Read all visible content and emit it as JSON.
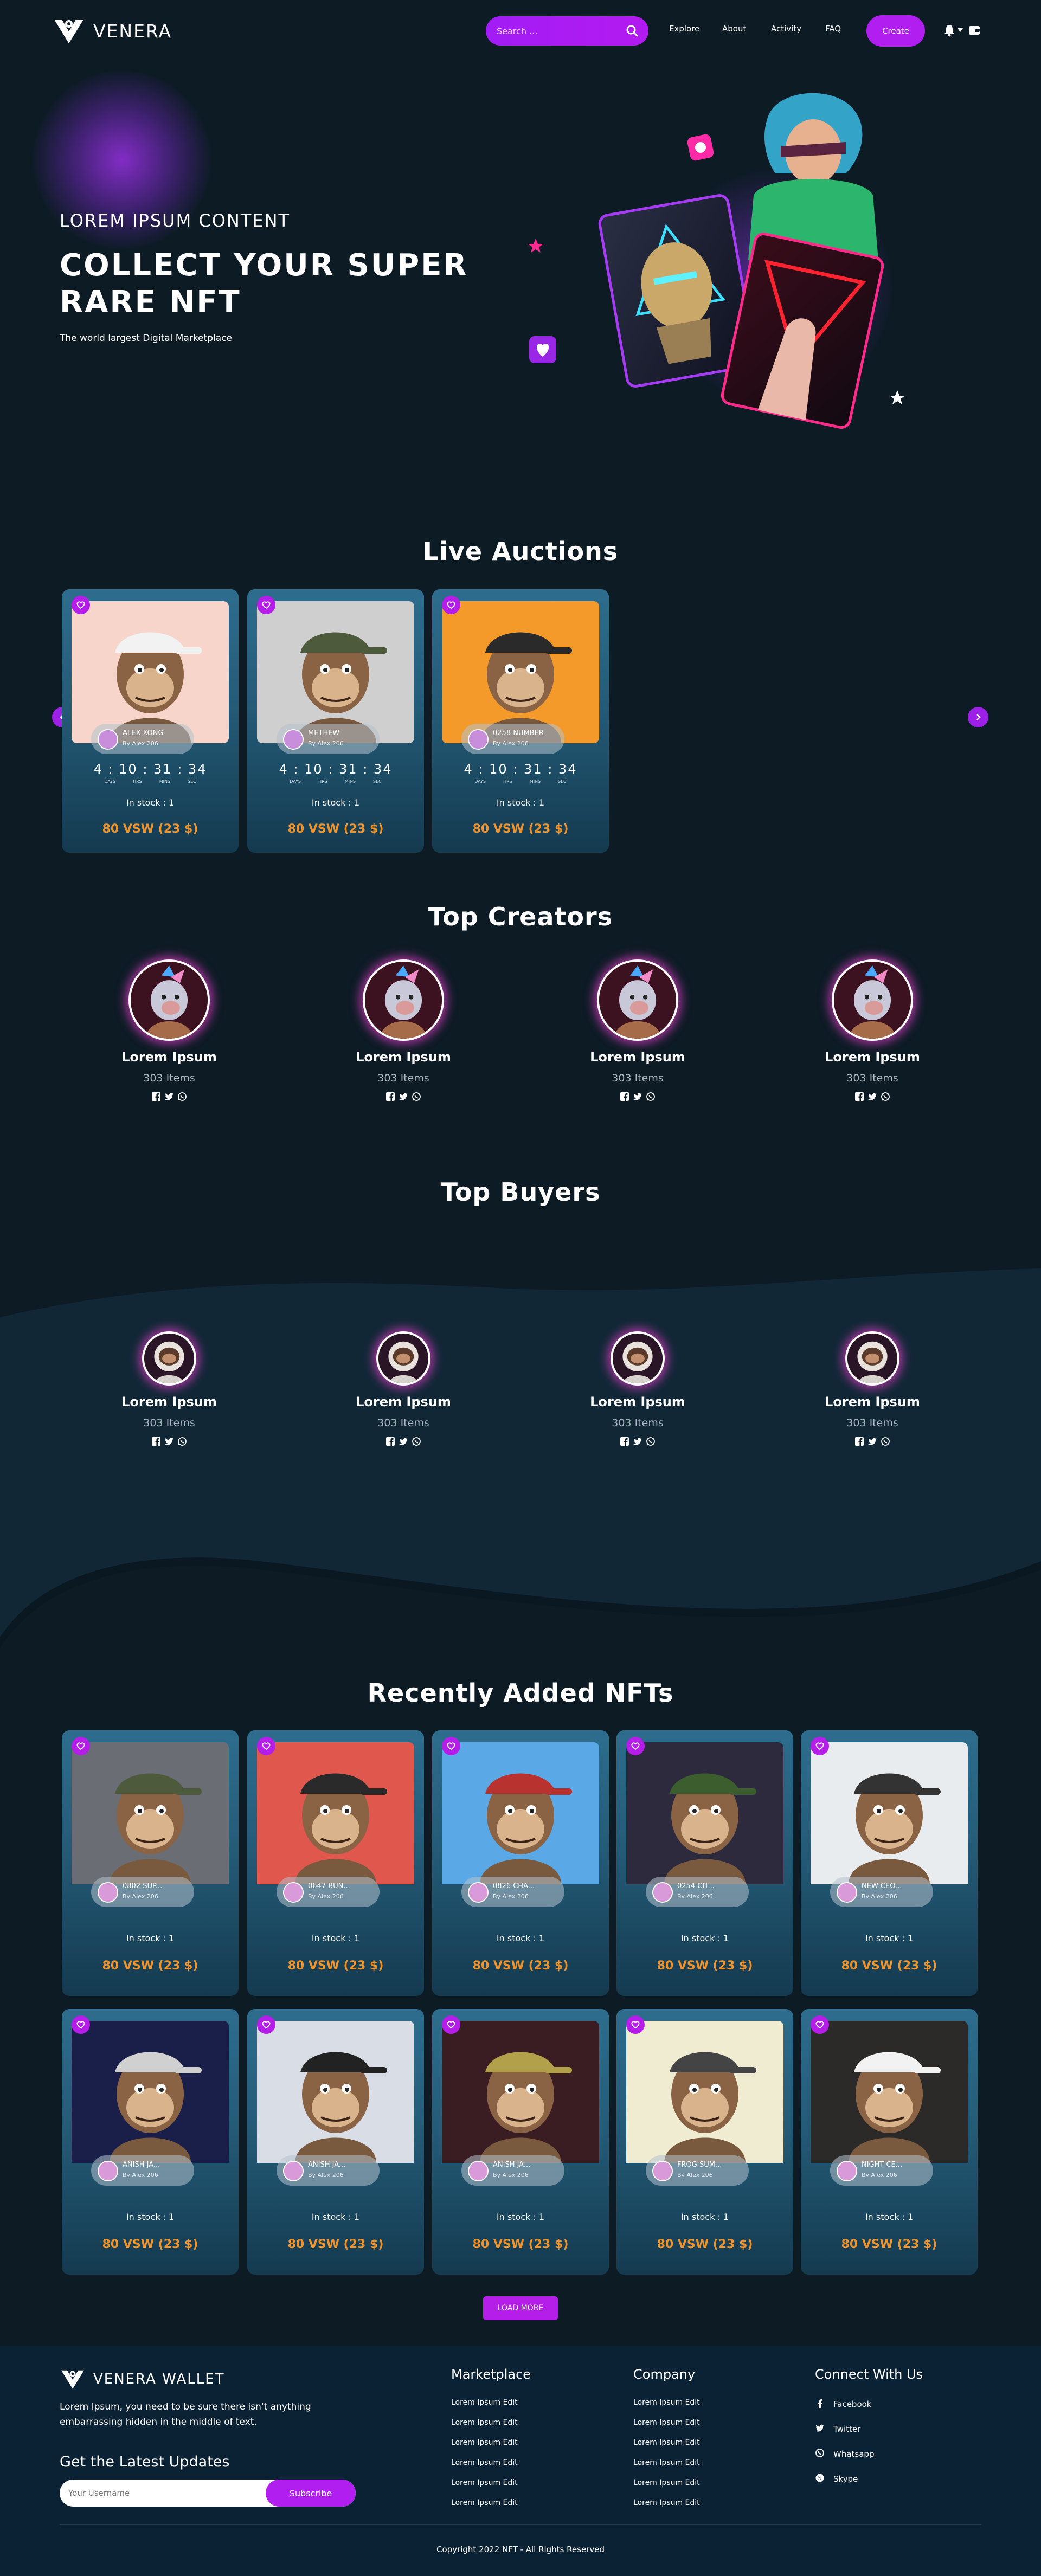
{
  "header": {
    "brand": "VENERA",
    "search_placeholder": "Search ...",
    "nav": [
      "Explore",
      "About",
      "Activity",
      "FAQ"
    ],
    "create_label": "Create"
  },
  "hero": {
    "kicker": "LOREM IPSUM CONTENT",
    "title": "COLLECT YOUR SUPER RARE NFT",
    "subtitle": "The world largest Digital Marketplace"
  },
  "live_auctions": {
    "title": "Live Auctions",
    "timer_units": [
      "DAYS",
      "HRS",
      "MINS",
      "SEC"
    ],
    "items": [
      {
        "name": "ALEX XONG",
        "by": "By Alex 206",
        "days": "4",
        "hrs": "10",
        "mins": "31",
        "secs": "34",
        "stock": "In stock : 1",
        "price": "80 VSW (23 $)",
        "bg": "#f7d5cb"
      },
      {
        "name": "METHEW",
        "by": "By Alex 206",
        "days": "4",
        "hrs": "10",
        "mins": "31",
        "secs": "34",
        "stock": "In stock : 1",
        "price": "80 VSW (23 $)",
        "bg": "#cfcfcf"
      },
      {
        "name": "0258 NUMBER",
        "by": "By Alex 206",
        "days": "4",
        "hrs": "10",
        "mins": "31",
        "secs": "34",
        "stock": "In stock : 1",
        "price": "80 VSW (23 $)",
        "bg": "#f39a2b"
      }
    ]
  },
  "top_creators": {
    "title": "Top Creators",
    "items": [
      {
        "name": "Lorem Ipsum",
        "items": "303 Items"
      },
      {
        "name": "Lorem Ipsum",
        "items": "303 Items"
      },
      {
        "name": "Lorem Ipsum",
        "items": "303 Items"
      },
      {
        "name": "Lorem Ipsum",
        "items": "303 Items"
      }
    ]
  },
  "top_buyers": {
    "title": "Top Buyers",
    "items": [
      {
        "name": "Lorem Ipsum",
        "items": "303 Items"
      },
      {
        "name": "Lorem Ipsum",
        "items": "303 Items"
      },
      {
        "name": "Lorem Ipsum",
        "items": "303 Items"
      },
      {
        "name": "Lorem Ipsum",
        "items": "303 Items"
      }
    ]
  },
  "recent": {
    "title": "Recently Added NFTs",
    "items": [
      {
        "name": "0802 SUP...",
        "by": "By Alex 206",
        "stock": "In stock : 1",
        "price": "80 VSW (23 $)",
        "bg": "#6a6e74"
      },
      {
        "name": "0647 BUN...",
        "by": "By Alex 206",
        "stock": "In stock : 1",
        "price": "80 VSW (23 $)",
        "bg": "#e0574e"
      },
      {
        "name": "0826 CHA...",
        "by": "By Alex 206",
        "stock": "In stock : 1",
        "price": "80 VSW (23 $)",
        "bg": "#5aa9e6"
      },
      {
        "name": "0254 CIT...",
        "by": "By Alex 206",
        "stock": "In stock : 1",
        "price": "80 VSW (23 $)",
        "bg": "#2d2a3e"
      },
      {
        "name": "NEW CEO...",
        "by": "By Alex 206",
        "stock": "In stock : 1",
        "price": "80 VSW (23 $)",
        "bg": "#e9ecef"
      },
      {
        "name": "ANISH JA...",
        "by": "By Alex 206",
        "stock": "In stock : 1",
        "price": "80 VSW (23 $)",
        "bg": "#1a1f4a"
      },
      {
        "name": "ANISH JA...",
        "by": "By Alex 206",
        "stock": "In stock : 1",
        "price": "80 VSW (23 $)",
        "bg": "#d9dde6"
      },
      {
        "name": "ANISH JA...",
        "by": "By Alex 206",
        "stock": "In stock : 1",
        "price": "80 VSW (23 $)",
        "bg": "#3a1d22"
      },
      {
        "name": "FROG SUM...",
        "by": "By Alex 206",
        "stock": "In stock : 1",
        "price": "80 VSW (23 $)",
        "bg": "#f0ecd2"
      },
      {
        "name": "NIGHT CE...",
        "by": "By Alex 206",
        "stock": "In stock : 1",
        "price": "80 VSW (23 $)",
        "bg": "#2b2a28"
      }
    ],
    "load_more": "LOAD MORE"
  },
  "footer": {
    "brand": "VENERA WALLET",
    "about": "Lorem Ipsum, you need to be sure there isn't anything embarrassing hidden in the middle of text.",
    "updates_title": "Get the Latest Updates",
    "email_placeholder": "Your Username",
    "subscribe_label": "Subscribe",
    "marketplace_title": "Marketplace",
    "marketplace_links": [
      "Lorem Ipsum Edit",
      "Lorem Ipsum Edit",
      "Lorem Ipsum Edit",
      "Lorem Ipsum Edit",
      "Lorem Ipsum Edit",
      "Lorem Ipsum Edit"
    ],
    "company_title": "Company",
    "company_links": [
      "Lorem Ipsum Edit",
      "Lorem Ipsum Edit",
      "Lorem Ipsum Edit",
      "Lorem Ipsum Edit",
      "Lorem Ipsum Edit",
      "Lorem Ipsum Edit"
    ],
    "connect_title": "Connect With Us",
    "social": [
      "Facebook",
      "Twitter",
      "Whatsapp",
      "Skype"
    ],
    "copyright": "Copyright 2022 NFT - All Rights Reserved"
  },
  "colors": {
    "accent": "#b01ef0",
    "price": "#f0932b",
    "bg": "#0d1b25",
    "card": "#2a6584"
  }
}
